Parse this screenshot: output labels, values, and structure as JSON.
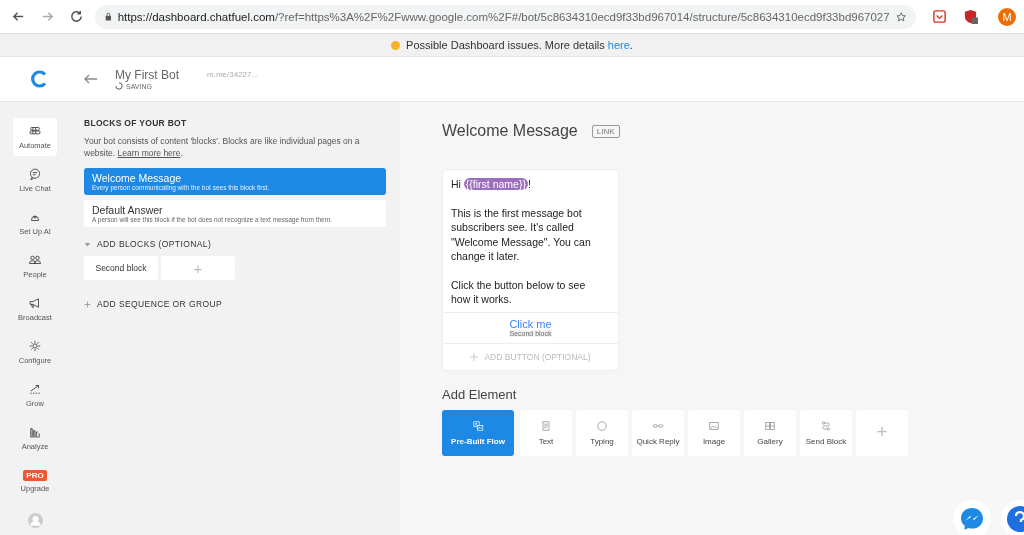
{
  "browser": {
    "url_host": "https://dashboard.chatfuel.com",
    "url_rest": "/?ref=https%3A%2F%2Fwww.google.com%2F#/bot/5c8634310ecd9f33bd967014/structure/5c8634310ecd9f33bd967027",
    "profile": "M"
  },
  "notice": {
    "text": "Possible Dashboard issues. More details ",
    "link": "here",
    "after": ".",
    "color": "#f5b325"
  },
  "header": {
    "bot_name": "My First Bot",
    "status": "SAVING",
    "link": "m.me/34227..."
  },
  "nav": [
    {
      "label": "Automate",
      "selected": true
    },
    {
      "label": "Live Chat",
      "selected": false
    },
    {
      "label": "Set Up AI",
      "selected": false
    },
    {
      "label": "People",
      "selected": false
    },
    {
      "label": "Broadcast",
      "selected": false
    },
    {
      "label": "Configure",
      "selected": false
    },
    {
      "label": "Grow",
      "selected": false
    },
    {
      "label": "Analyze",
      "selected": false
    },
    {
      "label": "Upgrade",
      "selected": false,
      "badge": "PRO"
    }
  ],
  "blocks": {
    "heading": "BLOCKS OF YOUR BOT",
    "intro": "Your bot consists of content 'blocks'. Blocks are like individual pages on a website. ",
    "learn_more": "Learn more here",
    "intro_end": ".",
    "items": [
      {
        "title": "Welcome Message",
        "desc": "Every person communicating with the bot sees this block first.",
        "selected": true
      },
      {
        "title": "Default Answer",
        "desc": "A person will see this block if the bot does not recognize a text message from them.",
        "selected": false
      }
    ],
    "add_blocks": {
      "label": "ADD BLOCKS (OPTIONAL)",
      "expanded": true,
      "items": [
        "Second block"
      ],
      "add": "+"
    },
    "add_sequence": {
      "label": "ADD SEQUENCE OR GROUP",
      "expanded": false
    }
  },
  "editor": {
    "title": "Welcome Message",
    "link_tag": "LINK",
    "card": {
      "greeting": "Hi ",
      "variable": "{{first name}}",
      "greeting_end": "!",
      "paragraphs": [
        "This is the first message bot subscribers see. It's called \"Welcome Message\". You can change it later.",
        "Click the button below to see how it works."
      ],
      "button": {
        "label": "Click me",
        "target": "Second block"
      },
      "add_button": "ADD BUTTON (OPTIONAL)"
    },
    "add_element": {
      "heading": "Add Element",
      "items": [
        {
          "label": "Pre-Built Flow",
          "selected": true
        },
        {
          "label": "Text",
          "selected": false
        },
        {
          "label": "Typing",
          "selected": false
        },
        {
          "label": "Quick Reply",
          "selected": false
        },
        {
          "label": "Image",
          "selected": false
        },
        {
          "label": "Gallery",
          "selected": false
        },
        {
          "label": "Send Block",
          "selected": false
        }
      ],
      "more": "+"
    }
  }
}
